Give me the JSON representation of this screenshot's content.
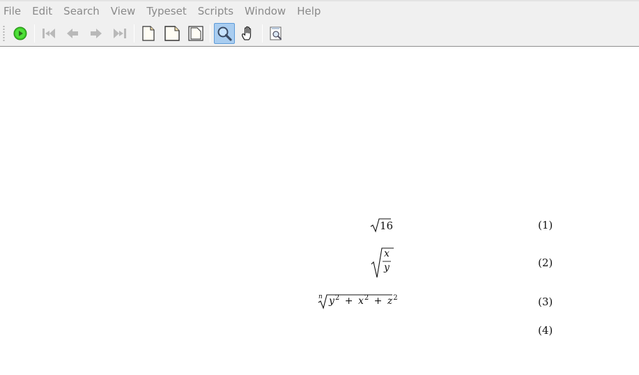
{
  "menu": {
    "items": [
      "File",
      "Edit",
      "Search",
      "View",
      "Typeset",
      "Scripts",
      "Window",
      "Help"
    ]
  },
  "toolbar": {
    "buttons": [
      {
        "icon": "typeset-run-icon"
      },
      {
        "icon": "first-page-icon"
      },
      {
        "icon": "previous-page-icon"
      },
      {
        "icon": "next-page-icon"
      },
      {
        "icon": "last-page-icon"
      },
      {
        "icon": "actual-size-icon"
      },
      {
        "icon": "fit-width-icon"
      },
      {
        "icon": "fit-window-icon"
      },
      {
        "icon": "magnify-tool-icon",
        "active": true
      },
      {
        "icon": "hand-tool-icon"
      },
      {
        "icon": "preview-search-icon"
      }
    ],
    "accent": "#a9cdf0"
  },
  "document": {
    "equations": [
      {
        "number": "(1)",
        "radicand": "16"
      },
      {
        "number": "(2)",
        "numerator": "x",
        "denominator": "y"
      },
      {
        "number": "(3)",
        "index": "n",
        "terms": [
          "y",
          "+",
          "x",
          "+",
          "z"
        ],
        "exponent": "2"
      },
      {
        "number": "(4)"
      }
    ]
  }
}
